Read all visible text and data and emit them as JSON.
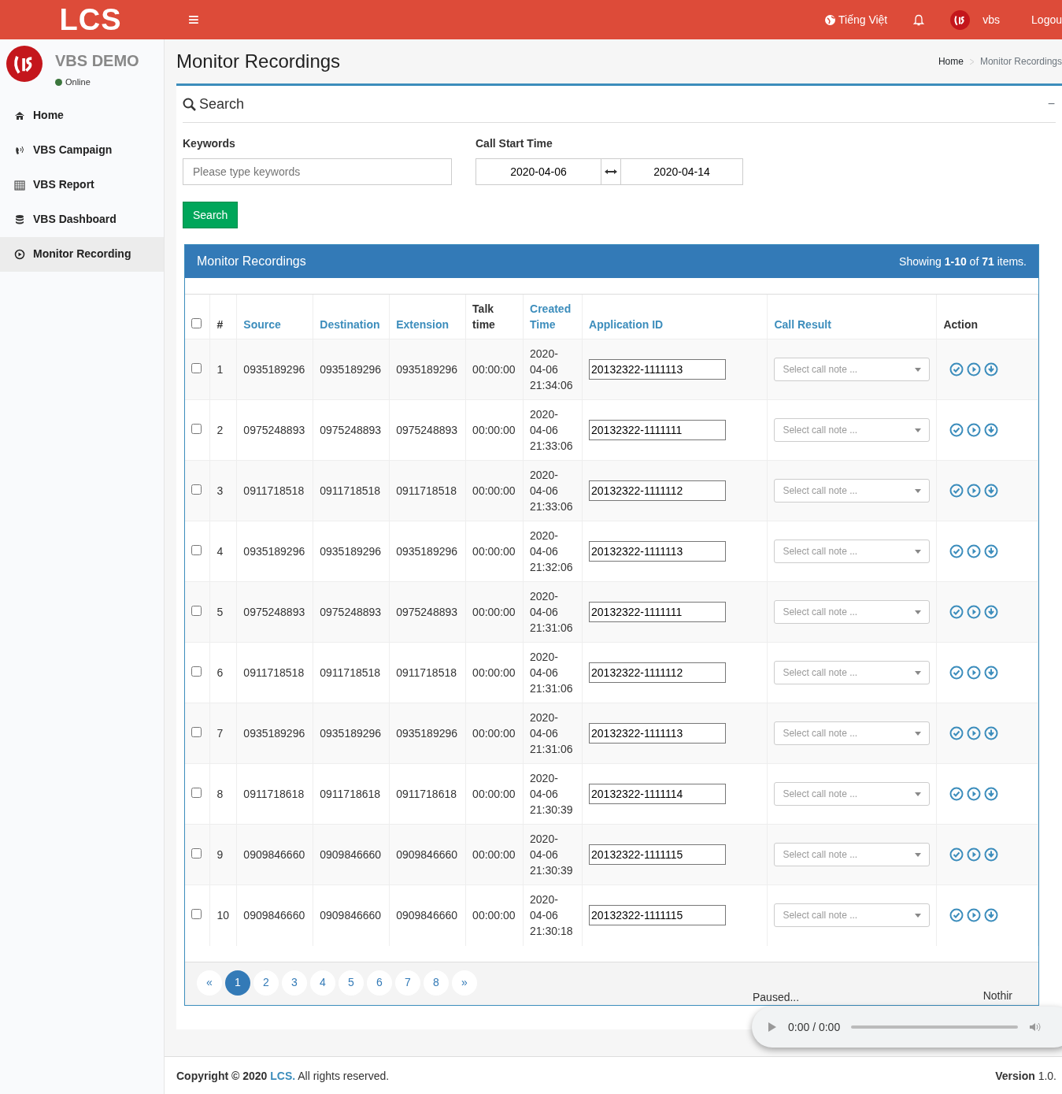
{
  "topbar": {
    "logo": "LCS",
    "menu_toggle": "≡",
    "language": "Tiếng Việt",
    "user": "vbs",
    "logout": "Logou"
  },
  "sidebar": {
    "name": "VBS DEMO",
    "status": "Online",
    "items": [
      {
        "label": "Home",
        "kind": "home",
        "selected": false
      },
      {
        "label": "VBS Campaign",
        "kind": "campaign",
        "selected": false
      },
      {
        "label": "VBS Report",
        "kind": "report",
        "selected": false
      },
      {
        "label": "VBS Dashboard",
        "kind": "dashboard",
        "selected": false
      },
      {
        "label": "Monitor Recording",
        "kind": "recording",
        "selected": true
      }
    ]
  },
  "page": {
    "title": "Monitor Recordings",
    "breadcrumb": [
      "Home",
      "Monitor Recordings"
    ]
  },
  "search": {
    "title": "Search",
    "collapse": "−",
    "keywords_label": "Keywords",
    "keywords_placeholder": "Please type keywords",
    "time_label": "Call Start Time",
    "from": "2020-04-06",
    "to": "2020-04-14",
    "button": "Search"
  },
  "results": {
    "title": "Monitor Recordings",
    "summary": "Showing **1-10** of **71** items.",
    "columns": [
      {
        "label": "#",
        "link": false
      },
      {
        "label": "Source",
        "link": true
      },
      {
        "label": "Destination",
        "link": true
      },
      {
        "label": "Extension",
        "link": true
      },
      {
        "label": "Talk time",
        "link": false
      },
      {
        "label": "Created Time",
        "link": true
      },
      {
        "label": "Application ID",
        "link": true
      },
      {
        "label": "Call Result",
        "link": true
      },
      {
        "label": "Action",
        "link": false
      }
    ],
    "select_all": false,
    "rows": [
      {
        "checked": false,
        "num": "1",
        "source": "0935189296",
        "destination": "0935189296",
        "extension": "0935189296",
        "talk_time": "00:00:00",
        "created": "2020-04-06 21:34:06",
        "application_id": "20132322-1111113",
        "call_result_placeholder": "Select call note ..."
      },
      {
        "checked": false,
        "num": "2",
        "source": "0975248893",
        "destination": "0975248893",
        "extension": "0975248893",
        "talk_time": "00:00:00",
        "created": "2020-04-06 21:33:06",
        "application_id": "20132322-1111111",
        "call_result_placeholder": "Select call note ..."
      },
      {
        "checked": false,
        "num": "3",
        "source": "0911718518",
        "destination": "0911718518",
        "extension": "0911718518",
        "talk_time": "00:00:00",
        "created": "2020-04-06 21:33:06",
        "application_id": "20132322-1111112",
        "call_result_placeholder": "Select call note ..."
      },
      {
        "checked": false,
        "num": "4",
        "source": "0935189296",
        "destination": "0935189296",
        "extension": "0935189296",
        "talk_time": "00:00:00",
        "created": "2020-04-06 21:32:06",
        "application_id": "20132322-1111113",
        "call_result_placeholder": "Select call note ..."
      },
      {
        "checked": false,
        "num": "5",
        "source": "0975248893",
        "destination": "0975248893",
        "extension": "0975248893",
        "talk_time": "00:00:00",
        "created": "2020-04-06 21:31:06",
        "application_id": "20132322-1111111",
        "call_result_placeholder": "Select call note ..."
      },
      {
        "checked": false,
        "num": "6",
        "source": "0911718518",
        "destination": "0911718518",
        "extension": "0911718518",
        "talk_time": "00:00:00",
        "created": "2020-04-06 21:31:06",
        "application_id": "20132322-1111112",
        "call_result_placeholder": "Select call note ..."
      },
      {
        "checked": false,
        "num": "7",
        "source": "0935189296",
        "destination": "0935189296",
        "extension": "0935189296",
        "talk_time": "00:00:00",
        "created": "2020-04-06 21:31:06",
        "application_id": "20132322-1111113",
        "call_result_placeholder": "Select call note ..."
      },
      {
        "checked": false,
        "num": "8",
        "source": "0911718618",
        "destination": "0911718618",
        "extension": "0911718618",
        "talk_time": "00:00:00",
        "created": "2020-04-06 21:30:39",
        "application_id": "20132322-1111114",
        "call_result_placeholder": "Select call note ..."
      },
      {
        "checked": false,
        "num": "9",
        "source": "0909846660",
        "destination": "0909846660",
        "extension": "0909846660",
        "talk_time": "00:00:00",
        "created": "2020-04-06 21:30:39",
        "application_id": "20132322-1111115",
        "call_result_placeholder": "Select call note ..."
      },
      {
        "checked": false,
        "num": "10",
        "source": "0909846660",
        "destination": "0909846660",
        "extension": "0909846660",
        "talk_time": "00:00:00",
        "created": "2020-04-06 21:30:18",
        "application_id": "20132322-1111115",
        "call_result_placeholder": "Select call note ..."
      }
    ],
    "pagination": [
      {
        "label": "«",
        "selected": false
      },
      {
        "label": "1",
        "selected": true
      },
      {
        "label": "2",
        "selected": false
      },
      {
        "label": "3",
        "selected": false
      },
      {
        "label": "4",
        "selected": false
      },
      {
        "label": "5",
        "selected": false
      },
      {
        "label": "6",
        "selected": false
      },
      {
        "label": "7",
        "selected": false
      },
      {
        "label": "8",
        "selected": false
      },
      {
        "label": "»",
        "selected": false
      }
    ],
    "player_status": "Paused...",
    "player_track": "Nothir"
  },
  "audio": {
    "time": "0:00 / 0:00"
  },
  "footer": {
    "copyright": "Copyright © 2020",
    "company": "LCS.",
    "rights": "All rights reserved.",
    "version_label": "Version",
    "version": "1.0."
  }
}
